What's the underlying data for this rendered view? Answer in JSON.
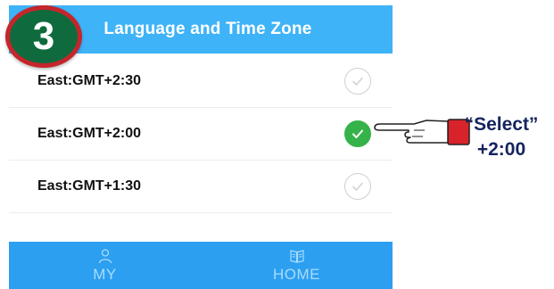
{
  "step": {
    "number": "3"
  },
  "header": {
    "title": "Language and Time Zone"
  },
  "timezones": [
    {
      "label": "East:GMT+2:30",
      "selected": false
    },
    {
      "label": "East:GMT+2:00",
      "selected": true
    },
    {
      "label": "East:GMT+1:30",
      "selected": false
    }
  ],
  "bottom_nav": [
    {
      "label": "MY",
      "icon": "person-icon"
    },
    {
      "label": "HOME",
      "icon": "book-icon"
    }
  ],
  "annotation": {
    "line1": "“Select”",
    "line2": "+2:00"
  },
  "colors": {
    "header": "#3fb3f7",
    "nav": "#2c9ff0",
    "checked": "#35b34a",
    "badge_fill": "#0f6b3e",
    "badge_ring": "#c4262b",
    "annotation_text": "#15245e"
  }
}
